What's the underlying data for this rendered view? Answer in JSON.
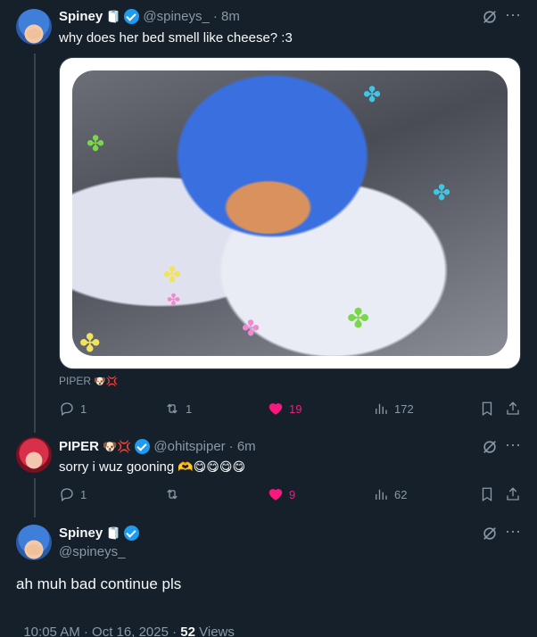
{
  "tweet1": {
    "name": "Spiney",
    "name_emoji": "🧻",
    "handle": "@spineys_",
    "time": "· 8m",
    "text": "why does her bed smell like cheese? :3",
    "tag_name": "PIPER",
    "tag_emojis": "🐶💢",
    "stats": {
      "replies": "1",
      "reposts": "1",
      "likes": "19",
      "views": "172"
    }
  },
  "tweet2": {
    "name": "PIPER",
    "name_emojis": "🐶💢",
    "handle": "@ohitspiper",
    "time": "· 6m",
    "text": "sorry i wuz gooning",
    "text_emojis": "🫶😋😋😋😋",
    "stats": {
      "replies": "1",
      "reposts": "",
      "likes": "9",
      "views": "62"
    }
  },
  "tweet3": {
    "name": "Spiney",
    "name_emoji": "🧻",
    "handle": "@spineys_",
    "text": "ah muh bad continue pls",
    "timestamp": "10:05 AM · Oct 16, 2025 · ",
    "views_count": "52",
    "views_label": "Views"
  },
  "colors": {
    "background": "#15202b",
    "accent": "#1d9bf0",
    "like": "#f91880",
    "muted": "#8b98a5"
  },
  "icons": [
    "grok-icon",
    "more-icon",
    "reply-icon",
    "repost-icon",
    "like-icon",
    "views-icon",
    "bookmark-icon",
    "share-icon",
    "verified-icon"
  ]
}
